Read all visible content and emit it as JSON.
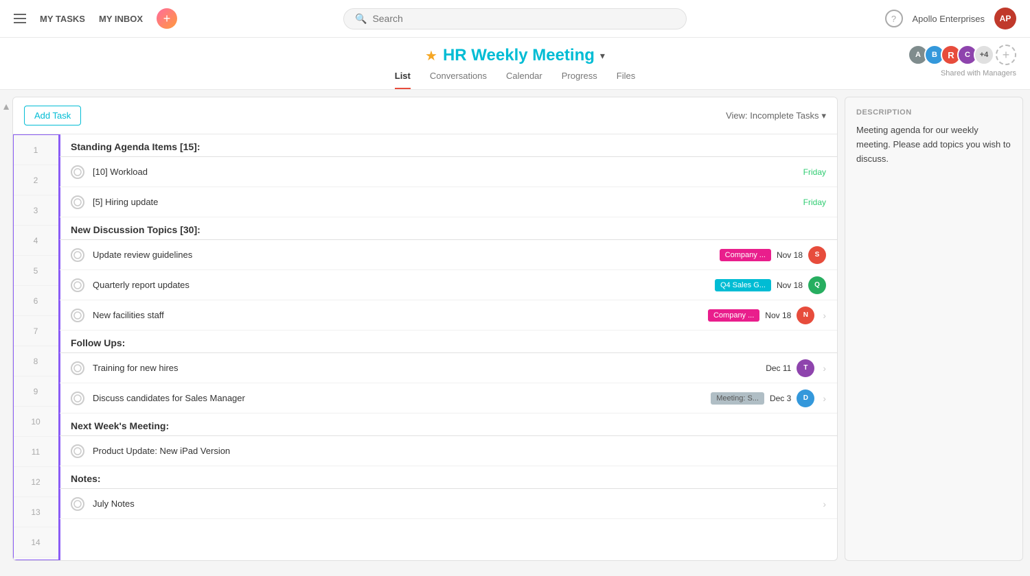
{
  "nav": {
    "my_tasks": "MY TASKS",
    "my_inbox": "MY INBOX",
    "search_placeholder": "Search",
    "company": "Apollo Enterprises",
    "help_label": "?"
  },
  "project": {
    "title": "HR Weekly Meeting",
    "tabs": [
      "List",
      "Conversations",
      "Calendar",
      "Progress",
      "Files"
    ],
    "active_tab": "List",
    "shared_label": "Shared with Managers",
    "members": [
      {
        "color": "#7f8c8d",
        "initials": "A"
      },
      {
        "color": "#3498db",
        "initials": "B"
      },
      {
        "color": "#e74c3c",
        "initials": "R"
      },
      {
        "color": "#8e44ad",
        "initials": "C"
      },
      {
        "extra": "+4"
      }
    ]
  },
  "toolbar": {
    "add_task_label": "Add Task",
    "view_label": "View: Incomplete Tasks",
    "view_chevron": "▾"
  },
  "description": {
    "title": "DESCRIPTION",
    "text": "Meeting agenda for our weekly meeting. Please add topics you wish to discuss."
  },
  "sections": [
    {
      "id": "standing",
      "title": "Standing Agenda Items [15]:",
      "row_start": 1,
      "tasks": [
        {
          "id": 2,
          "name": "[10] Workload",
          "date": "Friday",
          "date_color": "green"
        },
        {
          "id": 3,
          "name": "[5] Hiring update",
          "date": "Friday",
          "date_color": "green"
        }
      ]
    },
    {
      "id": "discussion",
      "title": "New Discussion Topics [30]:",
      "row_start": 4,
      "tasks": [
        {
          "id": 5,
          "name": "Update review guidelines",
          "tag": "Company ...",
          "tag_color": "pink",
          "date": "Nov 18",
          "avatar_color": "#e74c3c",
          "avatar_initials": "S"
        },
        {
          "id": 6,
          "name": "Quarterly report updates",
          "tag": "Q4 Sales G...",
          "tag_color": "teal",
          "date": "Nov 18",
          "avatar_color": "#27ae60",
          "avatar_initials": "Q"
        },
        {
          "id": 7,
          "name": "New facilities staff",
          "tag": "Company ...",
          "tag_color": "pink",
          "date": "Nov 18",
          "avatar_color": "#e74c3c",
          "avatar_initials": "N",
          "has_arrow": true
        }
      ]
    },
    {
      "id": "followups",
      "title": "Follow Ups:",
      "row_start": 8,
      "tasks": [
        {
          "id": 9,
          "name": "Training for new hires",
          "date": "Dec 11",
          "avatar_color": "#8e44ad",
          "avatar_initials": "T",
          "has_arrow": true
        },
        {
          "id": 10,
          "name": "Discuss candidates for Sales Manager",
          "tag": "Meeting: S...",
          "tag_color": "gray",
          "date": "Dec 3",
          "avatar_color": "#3498db",
          "avatar_initials": "D",
          "has_arrow": true
        }
      ]
    },
    {
      "id": "nextweek",
      "title": "Next Week's Meeting:",
      "row_start": 11,
      "tasks": [
        {
          "id": 12,
          "name": "Product Update: New iPad Version"
        }
      ]
    },
    {
      "id": "notes",
      "title": "Notes:",
      "row_start": 13,
      "tasks": [
        {
          "id": 14,
          "name": "July Notes",
          "has_arrow": true
        }
      ]
    }
  ],
  "row_numbers": [
    1,
    2,
    3,
    4,
    5,
    6,
    7,
    8,
    9,
    10,
    11,
    12,
    13,
    14
  ]
}
